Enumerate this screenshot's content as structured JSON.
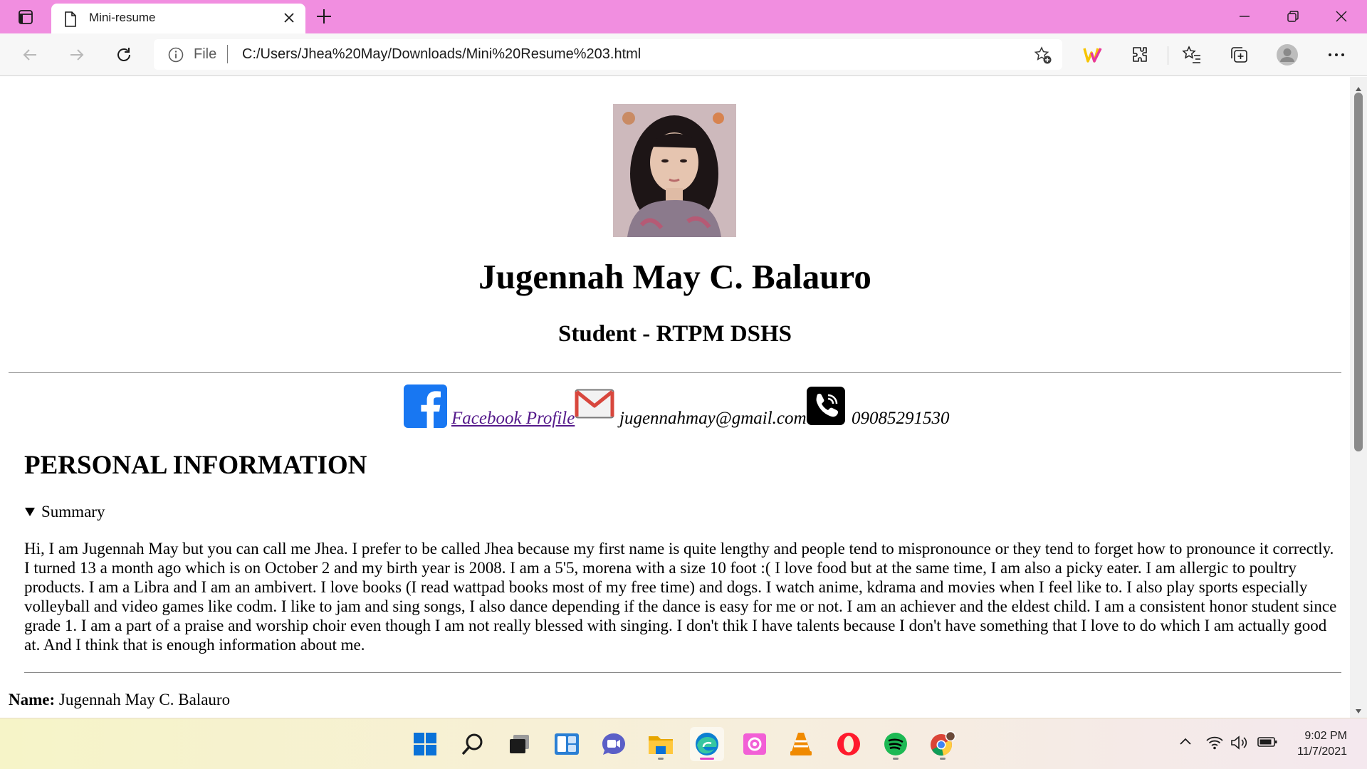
{
  "browser": {
    "tab_title": "Mini-resume",
    "scheme_label": "File",
    "url": "C:/Users/Jhea%20May/Downloads/Mini%20Resume%203.html"
  },
  "resume": {
    "name": "Jugennah May C. Balauro",
    "role": "Student - RTPM DSHS",
    "contacts": {
      "facebook_label": "Facebook Profile",
      "email": "jugennahmay@gmail.com",
      "phone": "09085291530"
    },
    "section_title": "PERSONAL INFORMATION",
    "summary_label": "Summary",
    "summary_text": "Hi, I am Jugennah May but you can call me Jhea. I prefer to be called Jhea because my first name is quite lengthy and people tend to mispronounce or they tend to forget how to pronounce it correctly. I turned 13 a month ago which is on October 2 and my birth year is 2008. I am a 5'5, morena with a size 10 foot :( I love food but at the same time, I am also a picky eater. I am allergic to poultry products. I am a Libra and I am an ambivert. I love books (I read wattpad books most of my free time) and dogs. I watch anime, kdrama and movies when I feel like to. I also play sports especially volleyball and video games like codm. I like to jam and sing songs, I also dance depending if the dance is easy for me or not. I am an achiever and the eldest child. I am a consistent honor student since grade 1. I am a part of a praise and worship choir even though I am not really blessed with singing. I don't thik I have talents because I don't have something that I love to do which I am actually good at. And I think that is enough information about me.",
    "name_label": "Name:",
    "name_value": "Jugennah May C. Balauro"
  },
  "taskbar": {
    "time": "9:02 PM",
    "date": "11/7/2021"
  },
  "colors": {
    "tabbar": "#f18ee0",
    "visited_link": "#551a8b",
    "facebook": "#1877f2"
  }
}
